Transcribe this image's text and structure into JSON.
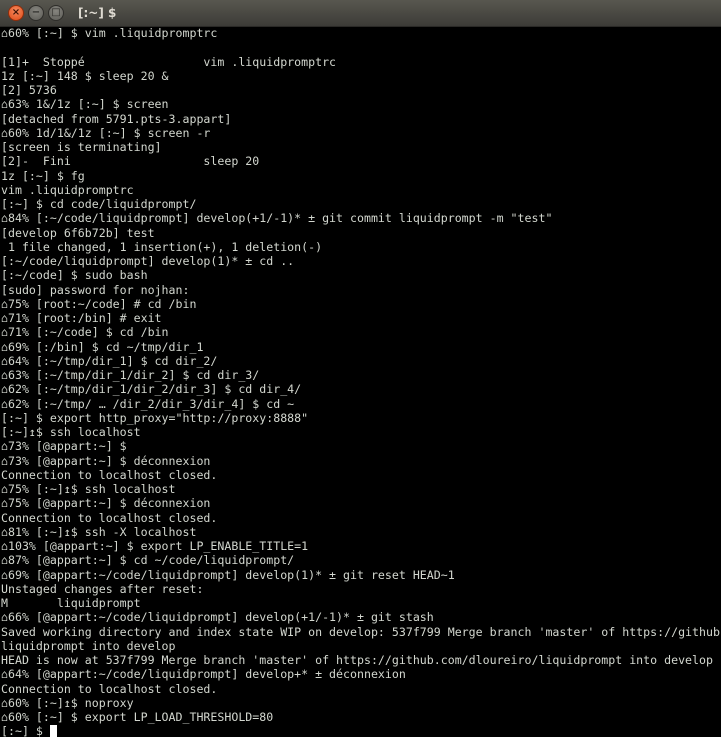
{
  "window": {
    "title": "[:~] $",
    "close_icon": "×",
    "minimize_icon": "−",
    "maximize_icon": "□"
  },
  "colors": {
    "background": "#000000",
    "foreground": "#d3d7cf",
    "prompt_bold": "#ffffff",
    "branch_red": "#cc0000",
    "branch_yellow": "#c4a000",
    "branch_green": "#4e9a06",
    "user_cyan": "#06989a",
    "host_purple": "#75507b",
    "root_red": "#ef2929"
  },
  "terminal": {
    "lines": [
      "⌂60% [:~] $ vim .liquidpromptrc",
      "",
      "[1]+  Stoppé                 vim .liquidpromptrc",
      "1z [:~] 148 $ sleep 20 &",
      "[2] 5736",
      "⌂63% 1&/1z [:~] $ screen",
      "[detached from 5791.pts-3.appart]",
      "⌂60% 1d/1&/1z [:~] $ screen -r",
      "[screen is terminating]",
      "[2]-  Fini                   sleep 20",
      "1z [:~] $ fg",
      "vim .liquidpromptrc",
      "[:~] $ cd code/liquidprompt/",
      "⌂84% [:~/code/liquidprompt] develop(+1/-1)* ± git commit liquidprompt -m \"test\"",
      "[develop 6f6b72b] test",
      " 1 file changed, 1 insertion(+), 1 deletion(-)",
      "[:~/code/liquidprompt] develop(1)* ± cd ..",
      "[:~/code] $ sudo bash",
      "[sudo] password for nojhan:",
      "⌂75% [root:~/code] # cd /bin",
      "⌂71% [root:/bin] # exit",
      "⌂71% [:~/code] $ cd /bin",
      "⌂69% [:/bin] $ cd ~/tmp/dir_1",
      "⌂64% [:~/tmp/dir_1] $ cd dir_2/",
      "⌂63% [:~/tmp/dir_1/dir_2] $ cd dir_3/",
      "⌂62% [:~/tmp/dir_1/dir_2/dir_3] $ cd dir_4/",
      "⌂62% [:~/tmp/ … /dir_2/dir_3/dir_4] $ cd ~",
      "[:~] $ export http_proxy=\"http://proxy:8888\"",
      "[:~]↥$ ssh localhost",
      "⌂73% [@appart:~] $",
      "⌂73% [@appart:~] $ déconnexion",
      "Connection to localhost closed.",
      "⌂75% [:~]↥$ ssh localhost",
      "⌂75% [@appart:~] $ déconnexion",
      "Connection to localhost closed.",
      "⌂81% [:~]↥$ ssh -X localhost",
      "⌂103% [@appart:~] $ export LP_ENABLE_TITLE=1",
      "⌂87% [@appart:~] $ cd ~/code/liquidprompt/",
      "⌂69% [@appart:~/code/liquidprompt] develop(1)* ± git reset HEAD~1",
      "Unstaged changes after reset:",
      "M       liquidprompt",
      "⌂66% [@appart:~/code/liquidprompt] develop(+1/-1)* ± git stash",
      "Saved working directory and index state WIP on develop: 537f799 Merge branch 'master' of https://github",
      "liquidprompt into develop",
      "HEAD is now at 537f799 Merge branch 'master' of https://github.com/dloureiro/liquidprompt into develop",
      "⌂64% [@appart:~/code/liquidprompt] develop+* ± déconnexion",
      "Connection to localhost closed.",
      "⌂60% [:~]↥$ noproxy",
      "⌂60% [:~] $ export LP_LOAD_THRESHOLD=80",
      "[:~] $ "
    ]
  }
}
